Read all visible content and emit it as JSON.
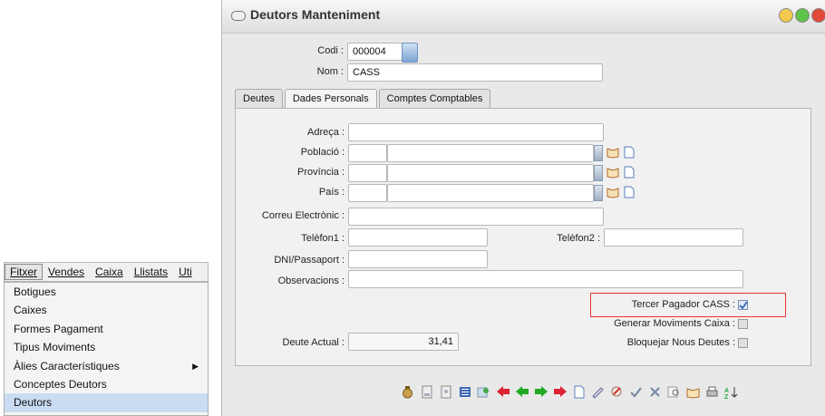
{
  "menu": {
    "bar": [
      "Fitxer",
      "Vendes",
      "Caixa",
      "Llistats",
      "Uti"
    ],
    "items": [
      {
        "label": "Botigues"
      },
      {
        "label": "Caixes"
      },
      {
        "label": "Formes Pagament"
      },
      {
        "label": "Tipus Moviments"
      },
      {
        "label": "Àlies Característiques",
        "submenu": true
      },
      {
        "label": "Conceptes Deutors"
      },
      {
        "label": "Deutors",
        "selected": true
      }
    ]
  },
  "window": {
    "title": "Deutors Manteniment",
    "buttons": {
      "colors": [
        "#f2c94c",
        "#5fc24a",
        "#e0483a"
      ]
    }
  },
  "header": {
    "codi_label": "Codi :",
    "codi_value": "000004",
    "nom_label": "Nom :",
    "nom_value": "CASS"
  },
  "tabs": [
    {
      "label": "Deutes",
      "active": false
    },
    {
      "label": "Dades Personals",
      "active": true
    },
    {
      "label": "Comptes Comptables",
      "active": false
    }
  ],
  "form": {
    "adreca": {
      "label": "Adreça :",
      "value": ""
    },
    "poblacio": {
      "label": "Població :",
      "code": "",
      "value": ""
    },
    "provincia": {
      "label": "Província :",
      "code": "",
      "value": ""
    },
    "pais": {
      "label": "País :",
      "code": "",
      "value": ""
    },
    "correu": {
      "label": "Correu Electrònic :",
      "value": ""
    },
    "telefon1": {
      "label": "Telèfon1 :",
      "value": ""
    },
    "telefon2": {
      "label": "Telèfon2 :",
      "value": ""
    },
    "dni": {
      "label": "DNI/Passaport :",
      "value": ""
    },
    "observacions": {
      "label": "Observacions :",
      "value": ""
    },
    "tercer_pagador": {
      "label": "Tercer Pagador CASS :",
      "checked": true
    },
    "generar_moviments": {
      "label": "Generar Moviments Caixa :",
      "checked": false
    },
    "bloquejar": {
      "label": "Bloquejar Nous Deutes :",
      "checked": false
    },
    "deute_actual": {
      "label": "Deute Actual :",
      "value": "31,41"
    }
  },
  "toolbar": {
    "icons": [
      "money-bag-icon",
      "first-record-icon",
      "page-copy-icon",
      "list-icon",
      "refresh-icon",
      "first-arrow-icon",
      "prev-arrow-icon",
      "next-arrow-icon",
      "last-arrow-icon",
      "new-icon",
      "edit-icon",
      "tools-icon",
      "confirm-icon",
      "cancel-icon",
      "search-icon",
      "book-icon",
      "print-icon",
      "sort-icon"
    ]
  }
}
